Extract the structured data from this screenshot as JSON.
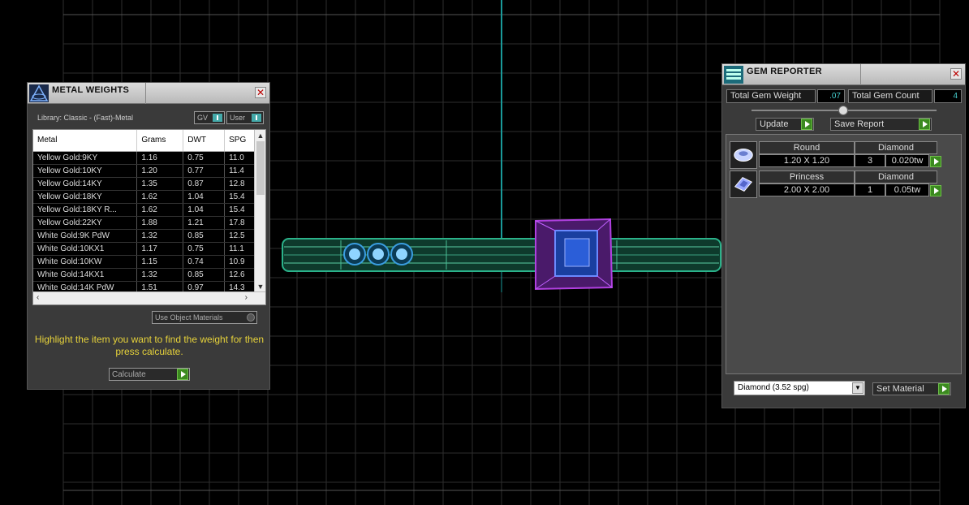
{
  "metal_weights": {
    "title": "METAL WEIGHTS",
    "library": "Library: Classic - (Fast)-Metal",
    "gv_label": "GV",
    "user_label": "User",
    "columns": [
      "Metal",
      "Grams",
      "DWT",
      "SPG"
    ],
    "rows": [
      [
        "Yellow Gold:9KY",
        "1.16",
        "0.75",
        "11.0"
      ],
      [
        "Yellow Gold:10KY",
        "1.20",
        "0.77",
        "11.4"
      ],
      [
        "Yellow Gold:14KY",
        "1.35",
        "0.87",
        "12.8"
      ],
      [
        "Yellow Gold:18KY",
        "1.62",
        "1.04",
        "15.4"
      ],
      [
        "Yellow Gold:18KY R...",
        "1.62",
        "1.04",
        "15.4"
      ],
      [
        "Yellow Gold:22KY",
        "1.88",
        "1.21",
        "17.8"
      ],
      [
        "White Gold:9K PdW",
        "1.32",
        "0.85",
        "12.5"
      ],
      [
        "White Gold:10KX1",
        "1.17",
        "0.75",
        "11.1"
      ],
      [
        "White Gold:10KW",
        "1.15",
        "0.74",
        "10.9"
      ],
      [
        "White Gold:14KX1",
        "1.32",
        "0.85",
        "12.6"
      ],
      [
        "White Gold:14K PdW",
        "1.51",
        "0.97",
        "14.3"
      ]
    ],
    "use_object_materials": "Use Object Materials",
    "hint": "Highlight the item you want to find the weight for then press calculate.",
    "calculate": "Calculate"
  },
  "gem_reporter": {
    "title": "GEM REPORTER",
    "total_weight_label": "Total Gem Weight",
    "total_weight_value": ".07",
    "total_count_label": "Total Gem Count",
    "total_count_value": "4",
    "update_label": "Update",
    "save_report_label": "Save Report",
    "gems": [
      {
        "shape": "Round",
        "type": "Diamond",
        "size": "1.20 X 1.20",
        "count": "3",
        "weight": "0.020tw"
      },
      {
        "shape": "Princess",
        "type": "Diamond",
        "size": "2.00 X 2.00",
        "count": "1",
        "weight": "0.05tw"
      }
    ],
    "material_select": "Diamond    (3.52 spg)",
    "set_material_label": "Set Material"
  }
}
